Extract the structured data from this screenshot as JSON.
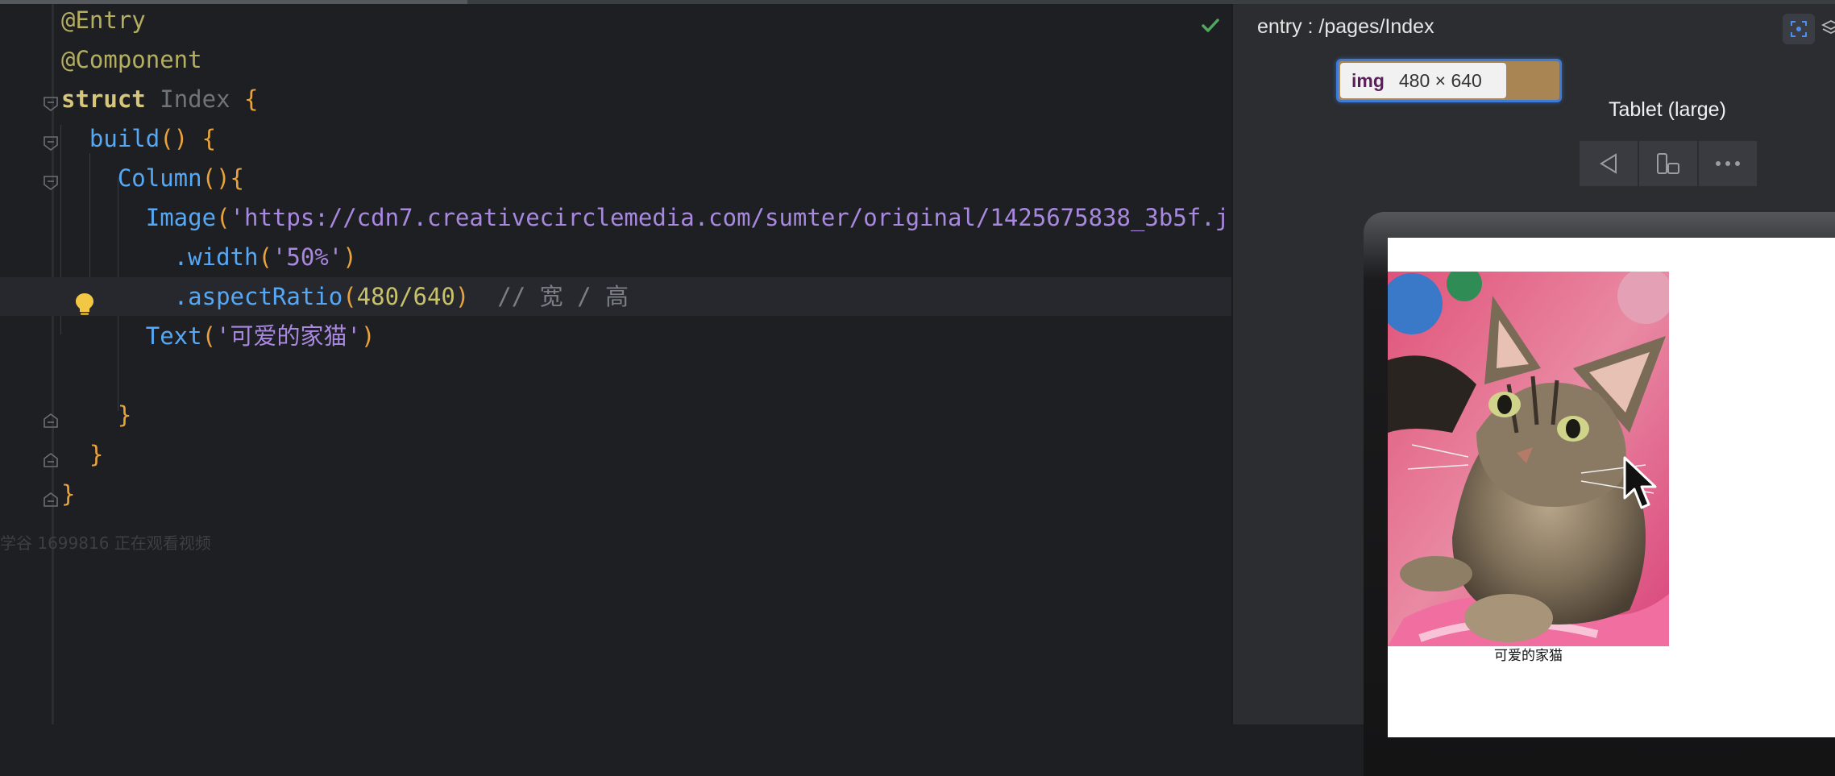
{
  "editor": {
    "lines": [
      {
        "tokens": [
          {
            "t": "@Entry",
            "c": "t-ann"
          }
        ]
      },
      {
        "tokens": [
          {
            "t": "@Component",
            "c": "t-ann"
          }
        ]
      },
      {
        "tokens": [
          {
            "t": "struct",
            "c": "t-kw"
          },
          {
            "t": " ",
            "c": "t-pn"
          },
          {
            "t": "Index",
            "c": "t-ty"
          },
          {
            "t": " ",
            "c": "t-pn"
          },
          {
            "t": "{",
            "c": "t-br"
          }
        ]
      },
      {
        "tokens": [
          {
            "t": "  ",
            "c": "t-pn"
          },
          {
            "t": "build",
            "c": "t-fn"
          },
          {
            "t": "()",
            "c": "t-br"
          },
          {
            "t": " ",
            "c": "t-pn"
          },
          {
            "t": "{",
            "c": "t-br"
          }
        ]
      },
      {
        "tokens": [
          {
            "t": "    ",
            "c": "t-pn"
          },
          {
            "t": "Column",
            "c": "t-fn"
          },
          {
            "t": "(){",
            "c": "t-br"
          }
        ]
      },
      {
        "tokens": [
          {
            "t": "      ",
            "c": "t-pn"
          },
          {
            "t": "Image",
            "c": "t-fn"
          },
          {
            "t": "(",
            "c": "t-br"
          },
          {
            "t": "'https://cdn7.creativecirclemedia.com/sumter/original/1425675838_3b5f.j",
            "c": "t-str"
          }
        ]
      },
      {
        "tokens": [
          {
            "t": "        ",
            "c": "t-pn"
          },
          {
            "t": ".width",
            "c": "t-fn"
          },
          {
            "t": "(",
            "c": "t-br"
          },
          {
            "t": "'50%'",
            "c": "t-str"
          },
          {
            "t": ")",
            "c": "t-br"
          }
        ]
      },
      {
        "tokens": [
          {
            "t": "        ",
            "c": "t-pn"
          },
          {
            "t": ".aspectRatio",
            "c": "t-fn"
          },
          {
            "t": "(",
            "c": "t-br"
          },
          {
            "t": "480/640",
            "c": "t-num"
          },
          {
            "t": ")",
            "c": "t-br"
          },
          {
            "t": "  // 宽 / 高",
            "c": "t-com"
          }
        ]
      },
      {
        "tokens": [
          {
            "t": "      ",
            "c": "t-pn"
          },
          {
            "t": "Text",
            "c": "t-fn"
          },
          {
            "t": "(",
            "c": "t-br"
          },
          {
            "t": "'可爱的家猫'",
            "c": "t-str"
          },
          {
            "t": ")",
            "c": "t-br"
          }
        ]
      },
      {
        "tokens": []
      },
      {
        "tokens": [
          {
            "t": "    ",
            "c": "t-pn"
          },
          {
            "t": "}",
            "c": "t-br"
          }
        ]
      },
      {
        "tokens": [
          {
            "t": "  ",
            "c": "t-pn"
          },
          {
            "t": "}",
            "c": "t-br"
          }
        ]
      },
      {
        "tokens": [
          {
            "t": "}",
            "c": "t-br"
          }
        ]
      }
    ],
    "current_line": 7,
    "watermark": "学谷 1699816 正在观看视频",
    "inspection_icon": "check-icon",
    "intention_icon": "lightbulb-icon"
  },
  "preview": {
    "title": "entry : /pages/Index",
    "tooltip": {
      "tag": "img",
      "size": "480 × 640"
    },
    "device_label": "Tablet (large)",
    "toolbar_icons": [
      "back-icon",
      "rotate-icon",
      "more-icon"
    ],
    "caption": "可爱的家猫"
  },
  "colors": {
    "editor_bg": "#1e1f22",
    "preview_bg": "#2b2d30",
    "selection_blue": "#3d7bd6",
    "tooltip_brown": "#a88552"
  }
}
